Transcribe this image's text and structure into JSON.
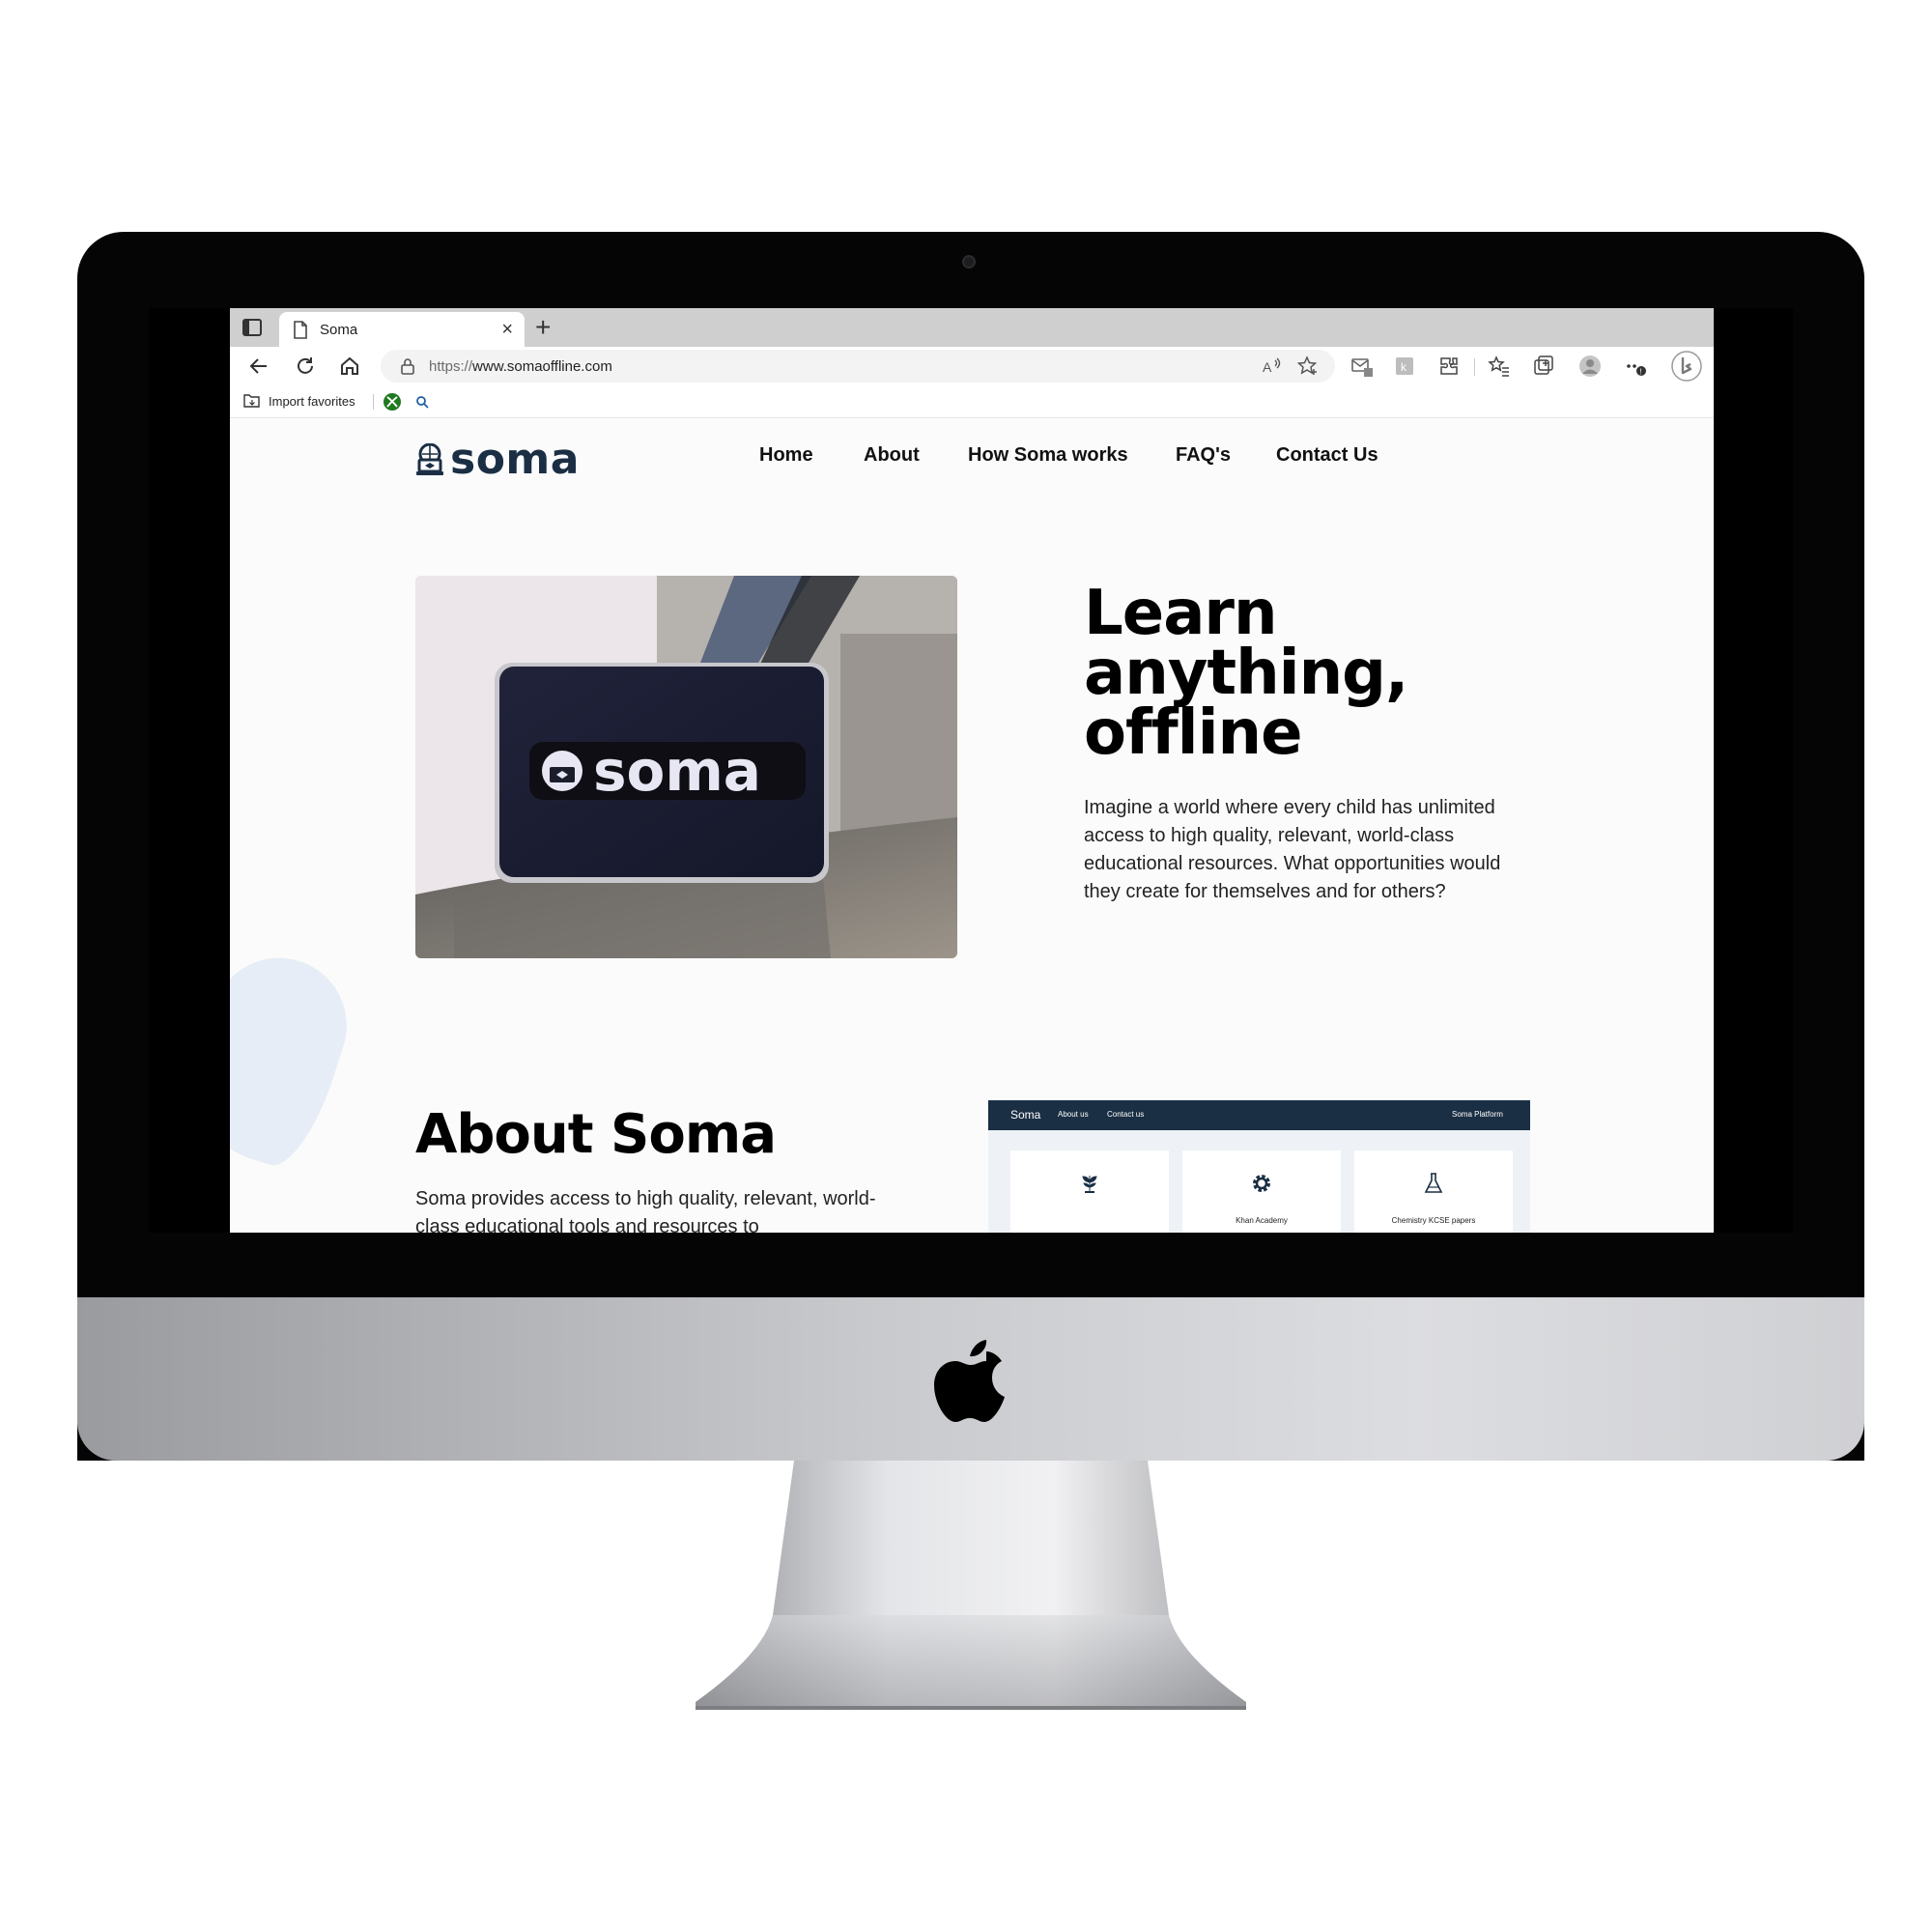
{
  "browser": {
    "tab_title": "Soma",
    "tab_close": "×",
    "new_tab": "+",
    "url_protocol": "https://",
    "url_host": "www.somaoffline.com",
    "favorites_import": "Import favorites"
  },
  "site": {
    "logo_text": "soma",
    "nav": [
      "Home",
      "About",
      "How Soma works",
      "FAQ's",
      "Contact Us"
    ],
    "hero_title_lines": [
      "Learn",
      "anything,",
      "offline"
    ],
    "hero_text": "Imagine a world where every child has unlimited access to high quality, relevant, world-class educational resources. What opportunities would they create for themselves and for others?",
    "hero_image_label": "soma",
    "about_title": "About Soma",
    "about_text": "Soma provides access to high quality, relevant, world-class educational tools and resources to",
    "preview": {
      "brand": "Soma",
      "links": [
        "About us",
        "Contact us"
      ],
      "right_link": "Soma Platform",
      "cards": [
        "",
        "Khan Academy",
        "Chemistry KCSE papers"
      ]
    }
  },
  "colors": {
    "brand_navy": "#1b2f44",
    "page_bg": "#fbfbfb",
    "tabbar_bg": "#cfcfcf"
  }
}
